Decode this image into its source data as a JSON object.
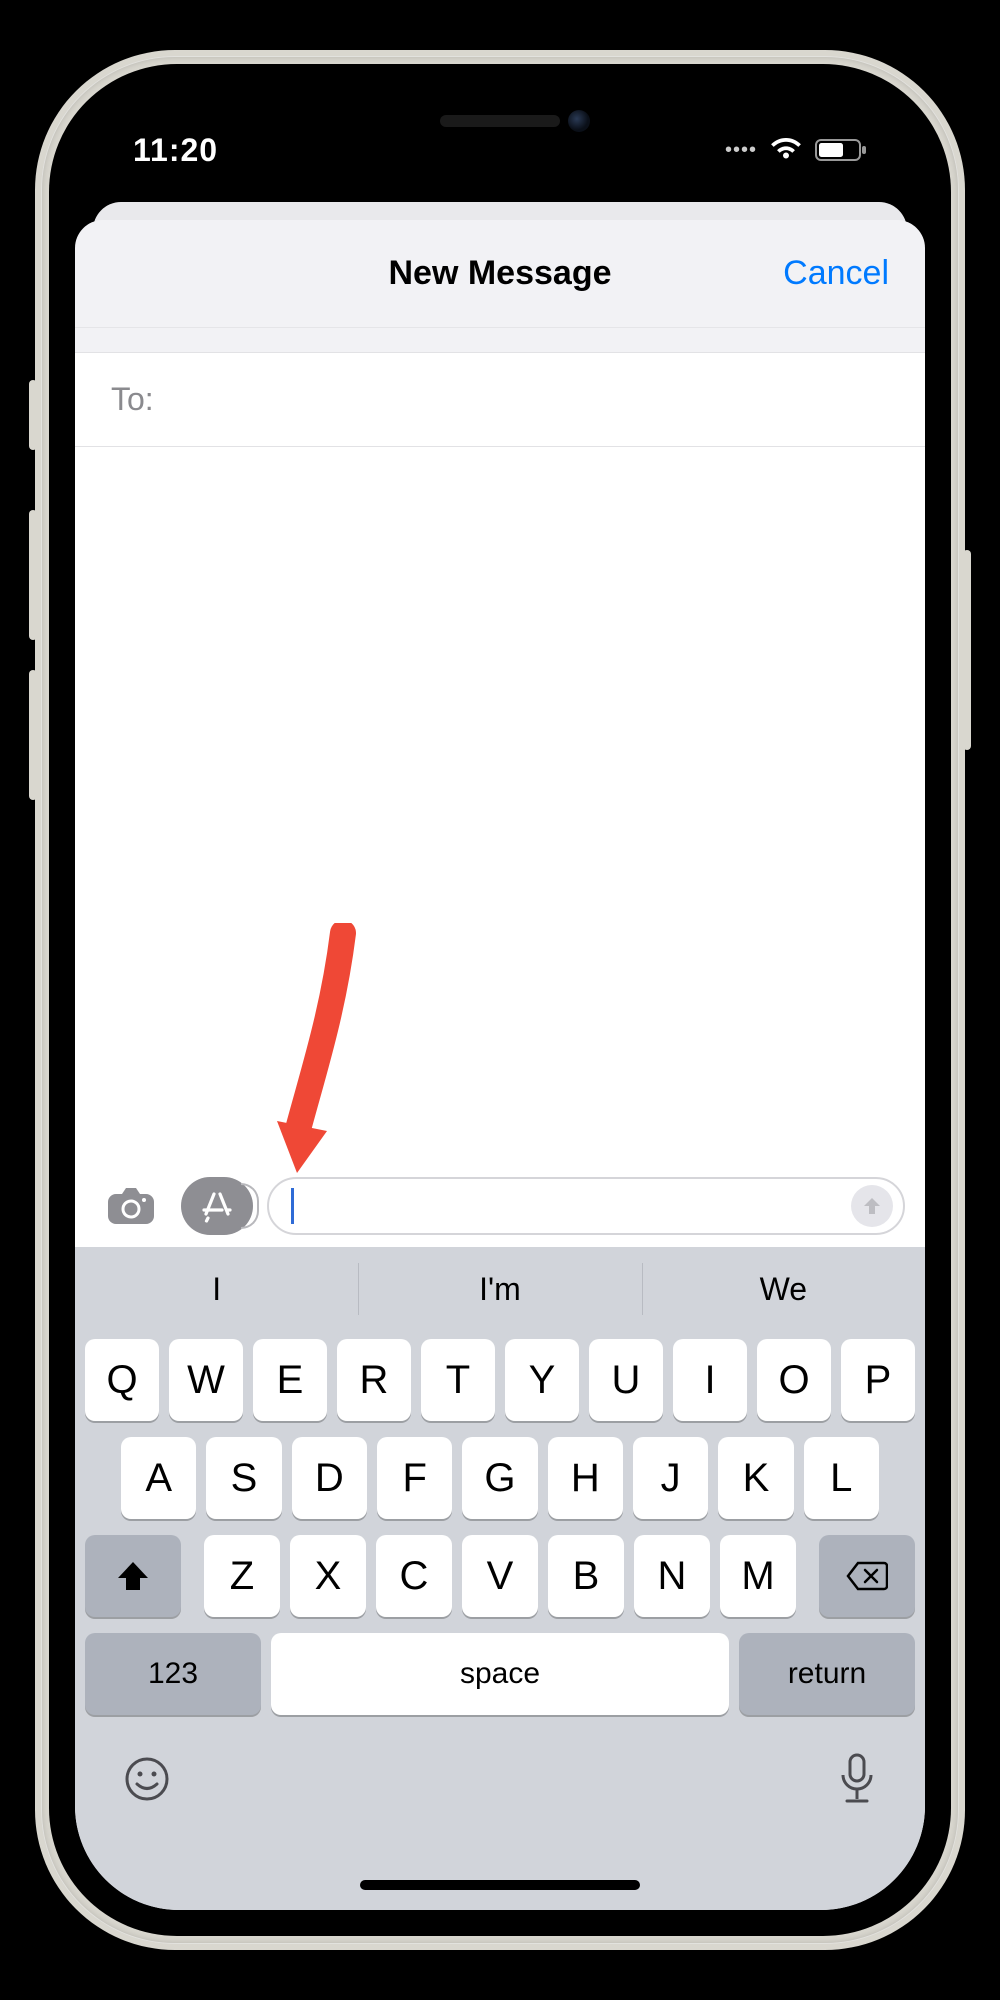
{
  "statusbar": {
    "time": "11:20"
  },
  "sheet": {
    "title": "New Message",
    "cancel": "Cancel",
    "to_label": "To:"
  },
  "compose": {
    "text": "",
    "placeholder": ""
  },
  "keyboard": {
    "suggestions": [
      "I",
      "I'm",
      "We"
    ],
    "row1": [
      "Q",
      "W",
      "E",
      "R",
      "T",
      "Y",
      "U",
      "I",
      "O",
      "P"
    ],
    "row2": [
      "A",
      "S",
      "D",
      "F",
      "G",
      "H",
      "J",
      "K",
      "L"
    ],
    "row3": [
      "Z",
      "X",
      "C",
      "V",
      "B",
      "N",
      "M"
    ],
    "numkey": "123",
    "space": "space",
    "return": "return"
  }
}
